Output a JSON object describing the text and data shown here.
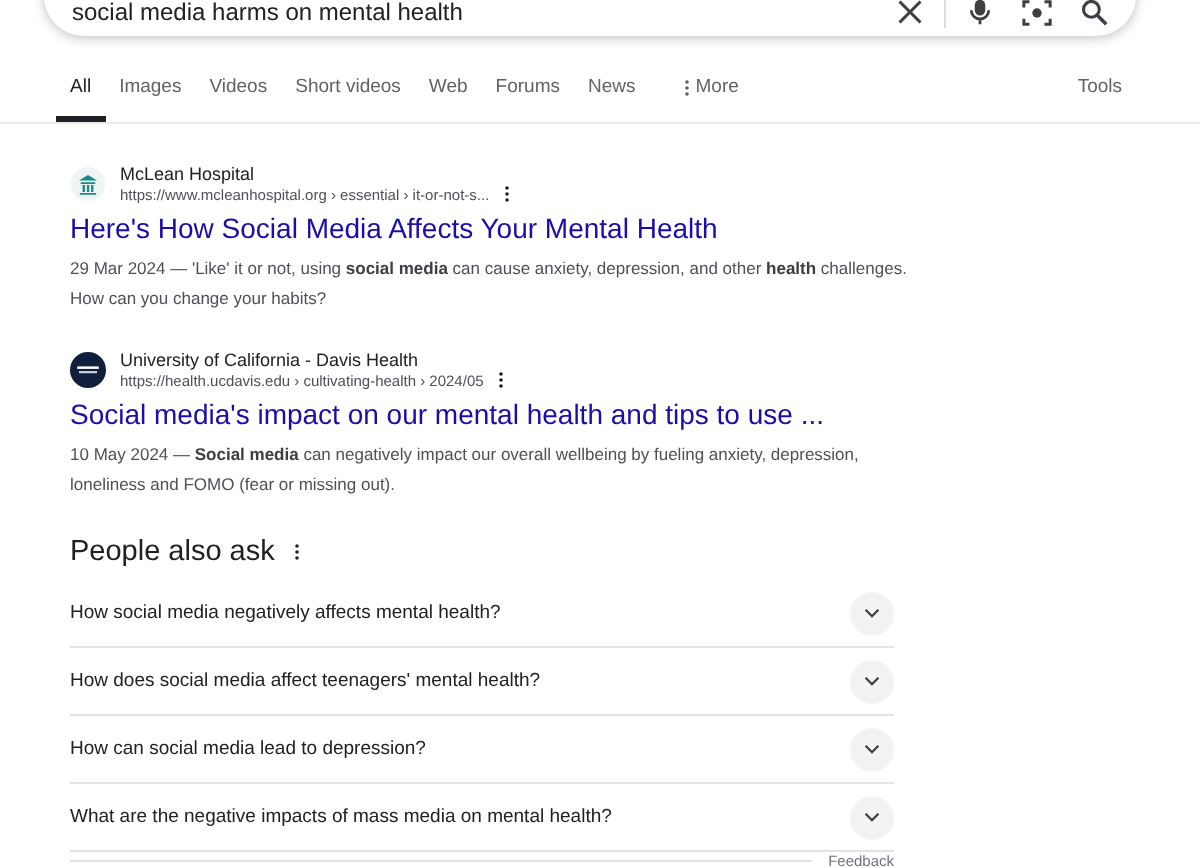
{
  "search": {
    "value": "social media harms on mental health"
  },
  "tabs": [
    {
      "label": "All",
      "selected": true
    },
    {
      "label": "Images",
      "selected": false
    },
    {
      "label": "Videos",
      "selected": false
    },
    {
      "label": "Short videos",
      "selected": false
    },
    {
      "label": "Web",
      "selected": false
    },
    {
      "label": "Forums",
      "selected": false
    },
    {
      "label": "News",
      "selected": false
    },
    {
      "label": "More",
      "selected": false
    }
  ],
  "tools": "Tools",
  "results": [
    {
      "kind": "hospital",
      "site": "McLean Hospital",
      "url": "https://www.mcleanhospital.org › essential › it-or-not-s...",
      "title": "Here's How Social Media Affects Your Mental Health",
      "snippet": "29 Mar 2024 — 'Like' it or not, using **social media** can cause anxiety, depression, and other **health** challenges. How can you change your habits?"
    },
    {
      "kind": "university",
      "site": "University of California - Davis Health",
      "url": "https://health.ucdavis.edu › cultivating-health › 2024/05",
      "title": "Social media's impact on our mental health and tips to use ...",
      "snippet": "10 May 2024 — **Social media** can negatively impact our overall wellbeing by fueling anxiety, depression, loneliness and FOMO (fear or missing out)."
    }
  ],
  "people_also_ask": {
    "title": "People also ask",
    "questions": [
      {
        "text": "How social media negatively affects mental health?",
        "expanded": false
      },
      {
        "text": "How does social media affect teenagers' mental health?",
        "expanded": false
      },
      {
        "text": "How can social media lead to depression?",
        "expanded": false
      },
      {
        "text": "What are the negative impacts of mass media on mental health?",
        "expanded": false
      }
    ],
    "feedback": "Feedback"
  }
}
